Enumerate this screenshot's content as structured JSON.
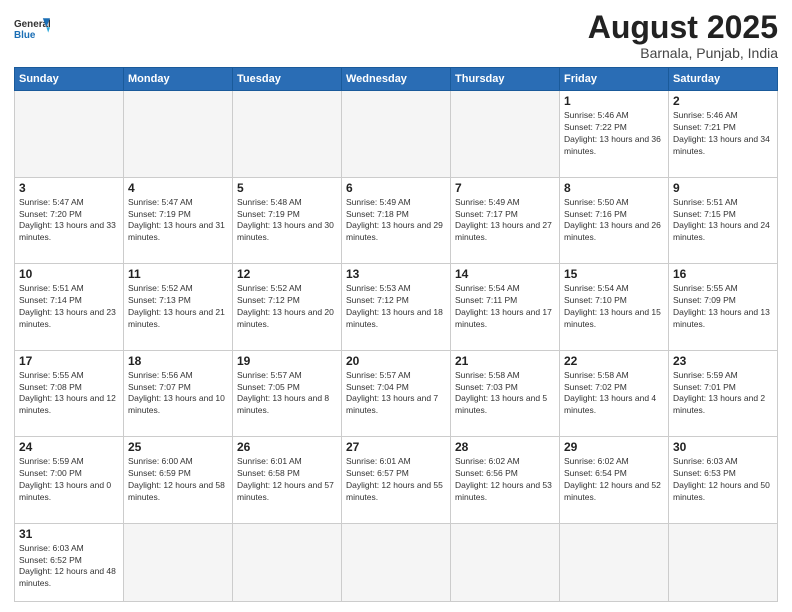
{
  "header": {
    "logo_general": "General",
    "logo_blue": "Blue",
    "month_title": "August 2025",
    "location": "Barnala, Punjab, India"
  },
  "weekdays": [
    "Sunday",
    "Monday",
    "Tuesday",
    "Wednesday",
    "Thursday",
    "Friday",
    "Saturday"
  ],
  "weeks": [
    [
      {
        "day": "",
        "empty": true
      },
      {
        "day": "",
        "empty": true
      },
      {
        "day": "",
        "empty": true
      },
      {
        "day": "",
        "empty": true
      },
      {
        "day": "",
        "empty": true
      },
      {
        "day": "1",
        "sunrise": "5:46 AM",
        "sunset": "7:22 PM",
        "daylight": "13 hours and 36 minutes."
      },
      {
        "day": "2",
        "sunrise": "5:46 AM",
        "sunset": "7:21 PM",
        "daylight": "13 hours and 34 minutes."
      }
    ],
    [
      {
        "day": "3",
        "sunrise": "5:47 AM",
        "sunset": "7:20 PM",
        "daylight": "13 hours and 33 minutes."
      },
      {
        "day": "4",
        "sunrise": "5:47 AM",
        "sunset": "7:19 PM",
        "daylight": "13 hours and 31 minutes."
      },
      {
        "day": "5",
        "sunrise": "5:48 AM",
        "sunset": "7:19 PM",
        "daylight": "13 hours and 30 minutes."
      },
      {
        "day": "6",
        "sunrise": "5:49 AM",
        "sunset": "7:18 PM",
        "daylight": "13 hours and 29 minutes."
      },
      {
        "day": "7",
        "sunrise": "5:49 AM",
        "sunset": "7:17 PM",
        "daylight": "13 hours and 27 minutes."
      },
      {
        "day": "8",
        "sunrise": "5:50 AM",
        "sunset": "7:16 PM",
        "daylight": "13 hours and 26 minutes."
      },
      {
        "day": "9",
        "sunrise": "5:51 AM",
        "sunset": "7:15 PM",
        "daylight": "13 hours and 24 minutes."
      }
    ],
    [
      {
        "day": "10",
        "sunrise": "5:51 AM",
        "sunset": "7:14 PM",
        "daylight": "13 hours and 23 minutes."
      },
      {
        "day": "11",
        "sunrise": "5:52 AM",
        "sunset": "7:13 PM",
        "daylight": "13 hours and 21 minutes."
      },
      {
        "day": "12",
        "sunrise": "5:52 AM",
        "sunset": "7:12 PM",
        "daylight": "13 hours and 20 minutes."
      },
      {
        "day": "13",
        "sunrise": "5:53 AM",
        "sunset": "7:12 PM",
        "daylight": "13 hours and 18 minutes."
      },
      {
        "day": "14",
        "sunrise": "5:54 AM",
        "sunset": "7:11 PM",
        "daylight": "13 hours and 17 minutes."
      },
      {
        "day": "15",
        "sunrise": "5:54 AM",
        "sunset": "7:10 PM",
        "daylight": "13 hours and 15 minutes."
      },
      {
        "day": "16",
        "sunrise": "5:55 AM",
        "sunset": "7:09 PM",
        "daylight": "13 hours and 13 minutes."
      }
    ],
    [
      {
        "day": "17",
        "sunrise": "5:55 AM",
        "sunset": "7:08 PM",
        "daylight": "13 hours and 12 minutes."
      },
      {
        "day": "18",
        "sunrise": "5:56 AM",
        "sunset": "7:07 PM",
        "daylight": "13 hours and 10 minutes."
      },
      {
        "day": "19",
        "sunrise": "5:57 AM",
        "sunset": "7:05 PM",
        "daylight": "13 hours and 8 minutes."
      },
      {
        "day": "20",
        "sunrise": "5:57 AM",
        "sunset": "7:04 PM",
        "daylight": "13 hours and 7 minutes."
      },
      {
        "day": "21",
        "sunrise": "5:58 AM",
        "sunset": "7:03 PM",
        "daylight": "13 hours and 5 minutes."
      },
      {
        "day": "22",
        "sunrise": "5:58 AM",
        "sunset": "7:02 PM",
        "daylight": "13 hours and 4 minutes."
      },
      {
        "day": "23",
        "sunrise": "5:59 AM",
        "sunset": "7:01 PM",
        "daylight": "13 hours and 2 minutes."
      }
    ],
    [
      {
        "day": "24",
        "sunrise": "5:59 AM",
        "sunset": "7:00 PM",
        "daylight": "13 hours and 0 minutes."
      },
      {
        "day": "25",
        "sunrise": "6:00 AM",
        "sunset": "6:59 PM",
        "daylight": "12 hours and 58 minutes."
      },
      {
        "day": "26",
        "sunrise": "6:01 AM",
        "sunset": "6:58 PM",
        "daylight": "12 hours and 57 minutes."
      },
      {
        "day": "27",
        "sunrise": "6:01 AM",
        "sunset": "6:57 PM",
        "daylight": "12 hours and 55 minutes."
      },
      {
        "day": "28",
        "sunrise": "6:02 AM",
        "sunset": "6:56 PM",
        "daylight": "12 hours and 53 minutes."
      },
      {
        "day": "29",
        "sunrise": "6:02 AM",
        "sunset": "6:54 PM",
        "daylight": "12 hours and 52 minutes."
      },
      {
        "day": "30",
        "sunrise": "6:03 AM",
        "sunset": "6:53 PM",
        "daylight": "12 hours and 50 minutes."
      }
    ],
    [
      {
        "day": "31",
        "sunrise": "6:03 AM",
        "sunset": "6:52 PM",
        "daylight": "12 hours and 48 minutes.",
        "lastrow": true
      },
      {
        "day": "",
        "empty": true,
        "lastrow": true
      },
      {
        "day": "",
        "empty": true,
        "lastrow": true
      },
      {
        "day": "",
        "empty": true,
        "lastrow": true
      },
      {
        "day": "",
        "empty": true,
        "lastrow": true
      },
      {
        "day": "",
        "empty": true,
        "lastrow": true
      },
      {
        "day": "",
        "empty": true,
        "lastrow": true
      }
    ]
  ]
}
